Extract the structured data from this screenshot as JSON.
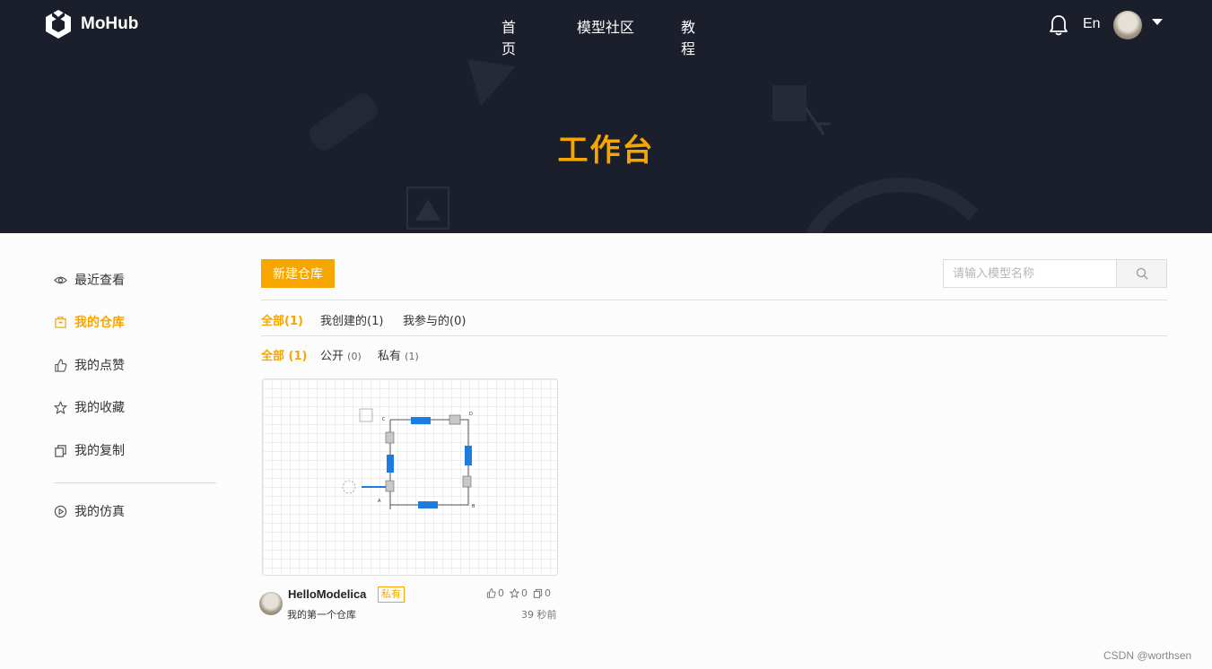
{
  "header": {
    "brand": "MoHub",
    "nav": [
      "首页",
      "模型社区",
      "教程"
    ],
    "lang": "En",
    "hero_title": "工作台"
  },
  "sidebar": {
    "items": [
      {
        "label": "最近查看",
        "icon": "eye-icon"
      },
      {
        "label": "我的仓库",
        "icon": "repo-icon",
        "active": true
      },
      {
        "label": "我的点赞",
        "icon": "thumbs-up-icon"
      },
      {
        "label": "我的收藏",
        "icon": "star-icon"
      },
      {
        "label": "我的复制",
        "icon": "copy-icon"
      },
      {
        "label": "我的仿真",
        "icon": "play-circle-icon"
      }
    ]
  },
  "main": {
    "new_repo_label": "新建仓库",
    "search_placeholder": "请输入模型名称",
    "tabs": [
      {
        "label": "全部(1)",
        "active": true
      },
      {
        "label": "我创建的(1)"
      },
      {
        "label": "我参与的(0)"
      }
    ],
    "filters": [
      {
        "label": "全部",
        "count": "(1)",
        "active": true
      },
      {
        "label": "公开",
        "count": "(0)"
      },
      {
        "label": "私有",
        "count": "(1)"
      }
    ]
  },
  "repos": [
    {
      "name": "HelloModelica",
      "badge": "私有",
      "description": "我的第一个仓库",
      "likes": "0",
      "stars": "0",
      "copies": "0",
      "time": "39 秒前",
      "diagram_labels": {
        "c": "C",
        "d": "D",
        "a": "A",
        "b": "B"
      }
    }
  ],
  "watermark": "CSDN @worthsen",
  "colors": {
    "accent": "#f7a600",
    "header_bg": "#1b1e2b",
    "component_blue": "#1e7be0"
  }
}
